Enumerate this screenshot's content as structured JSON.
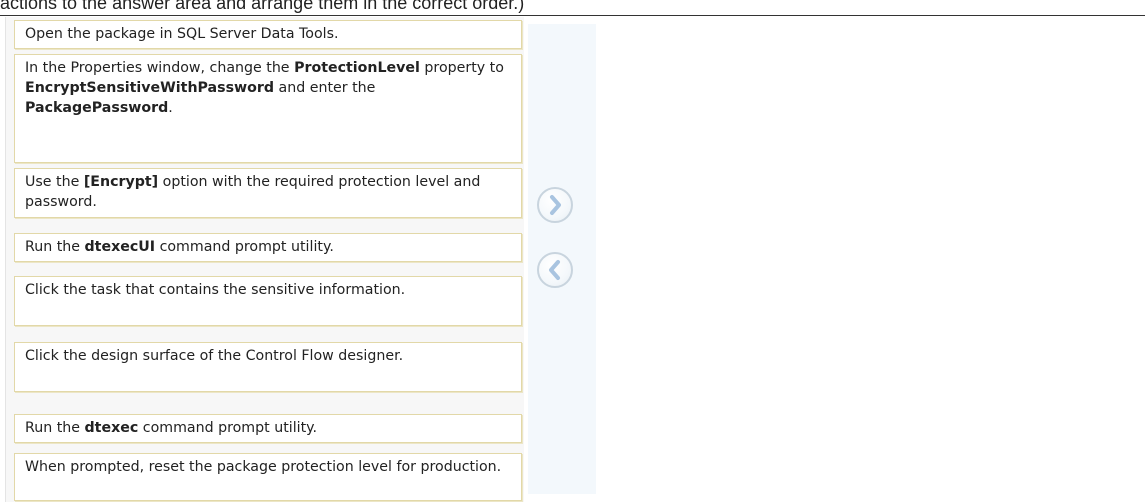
{
  "instruction_text": "actions to the answer area and arrange them in the correct order.)",
  "actions": [
    {
      "segments": [
        {
          "text": "Open the package in SQL Server Data Tools."
        }
      ]
    },
    {
      "segments": [
        {
          "text": "In the Properties window, change the "
        },
        {
          "text": "ProtectionLevel",
          "bold": true
        },
        {
          "text": " property to "
        },
        {
          "text": "EncryptSensitiveWithPassword",
          "bold": true
        },
        {
          "text": " and enter the "
        },
        {
          "text": "PackagePassword",
          "bold": true
        },
        {
          "text": "."
        }
      ]
    },
    {
      "segments": [
        {
          "text": "Use the "
        },
        {
          "text": "[Encrypt]",
          "bold": true
        },
        {
          "text": " option with the required protection level and password."
        }
      ]
    },
    {
      "segments": [
        {
          "text": "Run the "
        },
        {
          "text": "dtexecUI",
          "bold": true
        },
        {
          "text": " command prompt utility."
        }
      ]
    },
    {
      "segments": [
        {
          "text": "Click the task that contains the sensitive information."
        }
      ]
    },
    {
      "segments": [
        {
          "text": "Click the design surface of the Control Flow designer."
        }
      ]
    },
    {
      "segments": [
        {
          "text": "Run the "
        },
        {
          "text": "dtexec",
          "bold": true
        },
        {
          "text": " command prompt utility."
        }
      ]
    },
    {
      "segments": [
        {
          "text": "When prompted, reset the package protection level for production."
        }
      ]
    }
  ],
  "nav": {
    "move_right_icon": "chevron-right-icon",
    "move_left_icon": "chevron-left-icon"
  },
  "colors": {
    "item_border": "#e2d8a8",
    "divider_panel": "#f3f8fc",
    "nav_chevron": "#a9c4e0"
  }
}
